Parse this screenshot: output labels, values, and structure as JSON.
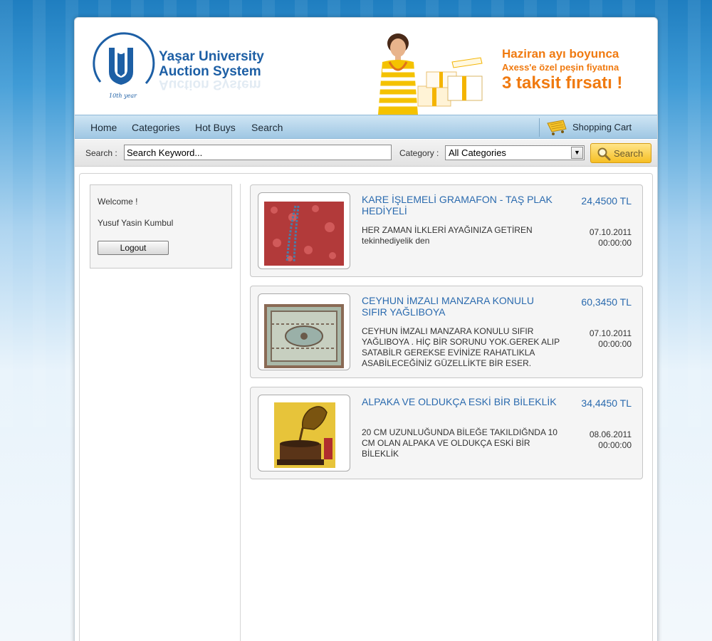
{
  "brand": {
    "line1": "Yaşar University",
    "line2": "Auction System",
    "logo_caption": "10th year"
  },
  "promo": {
    "line1": "Haziran ayı boyunca",
    "line2": "Axess'e özel peşin fiyatına",
    "line3": "3 taksit fırsatı !"
  },
  "nav": {
    "items": [
      "Home",
      "Categories",
      "Hot Buys",
      "Search"
    ],
    "cart_label": "Shopping Cart"
  },
  "search": {
    "label": "Search :",
    "value": "Search Keyword...",
    "category_label": "Category :",
    "category_selected": "All Categories",
    "button_label": "Search"
  },
  "sidebar": {
    "welcome": "Welcome !",
    "user": "Yusuf Yasin Kumbul",
    "logout": "Logout"
  },
  "items": [
    {
      "title": "KARE İŞLEMELİ GRAMAFON - TAŞ PLAK HEDİYELİ",
      "description": "HER ZAMAN İLKLERİ AYAĞINIZA GETİREN tekinhediyelik den",
      "price": "24,4500 TL",
      "date": "07.10.2011",
      "time": "00:00:00",
      "image": "necklace-on-red-fabric"
    },
    {
      "title": "CEYHUN İMZALI MANZARA KONULU SIFIR YAĞLIBOYA",
      "description": "CEYHUN İMZALI MANZARA KONULU SIFIR YAĞLIBOYA . HİÇ BİR SORUNU YOK.GEREK ALIP SATABİLR GEREKSE EVİNİZE RAHATLIKLA ASABİLECEĞİNİZ GÜZELLİKTE BİR ESER.",
      "price": "60,3450 TL",
      "date": "07.10.2011",
      "time": "00:00:00",
      "image": "patterned-rug"
    },
    {
      "title": "ALPAKA VE OLDUKÇA ESKİ BİR BİLEKLİK",
      "description": "20 CM UZUNLUĞUNDA BİLEĞE TAKILDIĞNDA 10 CM OLAN ALPAKA VE OLDUKÇA ESKİ BİR BİLEKLİK",
      "price": "34,4450 TL",
      "date": "08.06.2011",
      "time": "00:00:00",
      "image": "gramophone"
    }
  ],
  "colors": {
    "link_blue": "#2a6aae",
    "promo_orange": "#f07a10",
    "button_yellow": "#f6bf24"
  }
}
